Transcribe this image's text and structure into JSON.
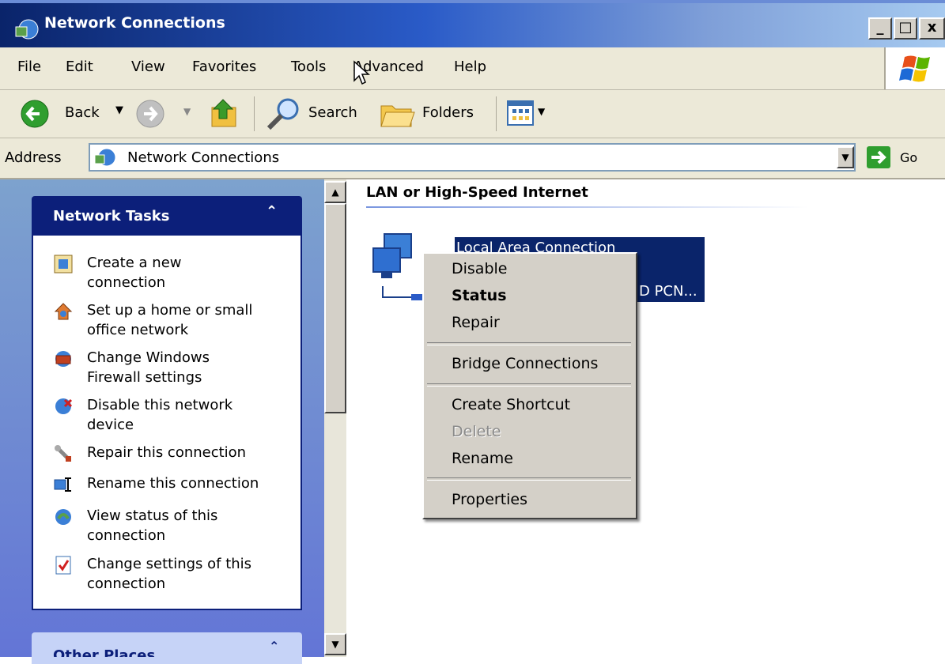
{
  "window": {
    "title": "Network Connections",
    "minimize": "_",
    "maximize": "□",
    "close": "x"
  },
  "menubar": [
    "File",
    "Edit",
    "View",
    "Favorites",
    "Tools",
    "Advanced",
    "Help"
  ],
  "toolbar": {
    "back": "Back",
    "search": "Search",
    "folders": "Folders"
  },
  "address": {
    "label": "Address",
    "value": "Network Connections",
    "go": "Go"
  },
  "tasks": {
    "title": "Network Tasks",
    "items": [
      [
        "Create a new",
        "connection"
      ],
      [
        "Set up a home or small",
        "office network"
      ],
      [
        "Change Windows",
        "Firewall settings"
      ],
      [
        "Disable this network",
        "device"
      ],
      [
        "Repair this connection"
      ],
      [
        "Rename this connection"
      ],
      [
        "View status of this",
        "connection"
      ],
      [
        "Change settings of this",
        "connection"
      ]
    ]
  },
  "other_places": {
    "title": "Other Places"
  },
  "group": {
    "title": "LAN or High-Speed Internet"
  },
  "connection": {
    "name": "Local Area Connection",
    "device_suffix": "D PCN..."
  },
  "context_menu": {
    "disable": "Disable",
    "status": "Status",
    "repair": "Repair",
    "bridge": "Bridge Connections",
    "shortcut": "Create Shortcut",
    "delete": "Delete",
    "rename": "Rename",
    "properties": "Properties"
  },
  "colors": {
    "title_bar": "#0a246a",
    "task_header": "#0c1f7a",
    "selection": "#0a246a",
    "menu_bg": "#d4d0c8"
  }
}
